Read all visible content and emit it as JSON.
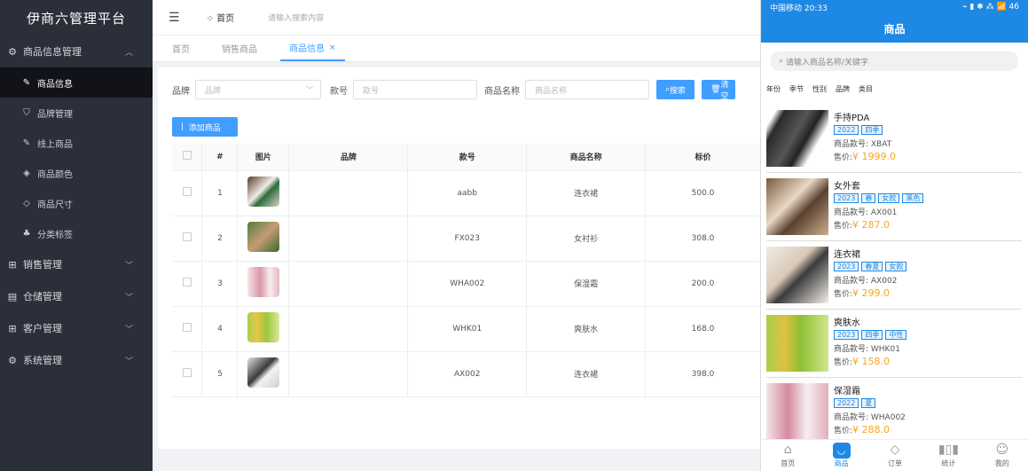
{
  "sidebar": {
    "brand": "伊商六管理平台",
    "groups": [
      {
        "label": "商品信息管理",
        "icon": "gear-icon"
      },
      {
        "label": "销售管理",
        "icon": "grid-icon"
      },
      {
        "label": "仓储管理",
        "icon": "box-icon"
      },
      {
        "label": "客户管理",
        "icon": "grid-icon"
      },
      {
        "label": "系统管理",
        "icon": "gear-icon"
      }
    ],
    "subitems": [
      {
        "label": "商品信息",
        "icon": "edit-icon"
      },
      {
        "label": "品牌管理",
        "icon": "shirt-icon"
      },
      {
        "label": "线上商品",
        "icon": "edit-icon"
      },
      {
        "label": "商品颜色",
        "icon": "shield-icon"
      },
      {
        "label": "商品尺寸",
        "icon": "tag-icon"
      },
      {
        "label": "分类标签",
        "icon": "tree-icon"
      }
    ]
  },
  "header": {
    "crumb": "首页",
    "search_placeholder": "请输入搜索内容"
  },
  "tabs": [
    {
      "label": "首页"
    },
    {
      "label": "销售商品"
    },
    {
      "label": "商品信息",
      "close": "×"
    }
  ],
  "filters": {
    "brand_label": "品牌",
    "brand_placeholder": "品牌",
    "code_label": "款号",
    "code_placeholder": "款号",
    "name_label": "商品名称",
    "name_placeholder": "商品名称",
    "search_btn": "搜索",
    "clear_btn": "清空"
  },
  "add_btn": "添加商品",
  "table": {
    "headers": [
      "#",
      "图片",
      "品牌",
      "款号",
      "商品名称",
      "标价"
    ],
    "rows": [
      {
        "idx": "1",
        "code": "aabb",
        "name": "连衣裙",
        "price": "500.0"
      },
      {
        "idx": "2",
        "code": "FX023",
        "name": "女衬衫",
        "price": "308.0"
      },
      {
        "idx": "3",
        "code": "WHA002",
        "name": "保湿霜",
        "price": "200.0"
      },
      {
        "idx": "4",
        "code": "WHK01",
        "name": "爽肤水",
        "price": "168.0"
      },
      {
        "idx": "5",
        "code": "AX002",
        "name": "连衣裙",
        "price": "398.0"
      }
    ]
  },
  "mobile": {
    "status_left": "中国移动 20:33",
    "status_right": "⌁ ▮ ✱ ⁂ 📶 46",
    "title": "商品",
    "search_placeholder": "请输入商品名称/关键字",
    "filters": [
      "年份",
      "季节",
      "性别",
      "品牌",
      "类目"
    ],
    "items": [
      {
        "name": "手持PDA",
        "tags": [
          "2022",
          "四季"
        ],
        "code": "商品款号: XBAT",
        "price_label": "售价:",
        "price": "¥ 1999.0"
      },
      {
        "name": "女外套",
        "tags": [
          "2023",
          "春",
          "女款",
          "黑色"
        ],
        "code": "商品款号: AX001",
        "price_label": "售价:",
        "price": "¥ 287.0"
      },
      {
        "name": "连衣裙",
        "tags": [
          "2023",
          "春夏",
          "女款"
        ],
        "code": "商品款号: AX002",
        "price_label": "售价:",
        "price": "¥ 299.0"
      },
      {
        "name": "爽肤水",
        "tags": [
          "2023",
          "四季",
          "中性"
        ],
        "code": "商品款号: WHK01",
        "price_label": "售价:",
        "price": "¥ 158.0"
      },
      {
        "name": "保湿霜",
        "tags": [
          "2022",
          "夏"
        ],
        "code": "商品款号: WHA002",
        "price_label": "售价:",
        "price": "¥ 288.0"
      }
    ],
    "tabbar": [
      "首页",
      "商品",
      "订单",
      "统计",
      "我的"
    ]
  },
  "colors": {
    "primary": "#409eff",
    "sidebar": "#2b2f3a",
    "mobile_header": "#1e88e5",
    "price": "#f5a623"
  }
}
